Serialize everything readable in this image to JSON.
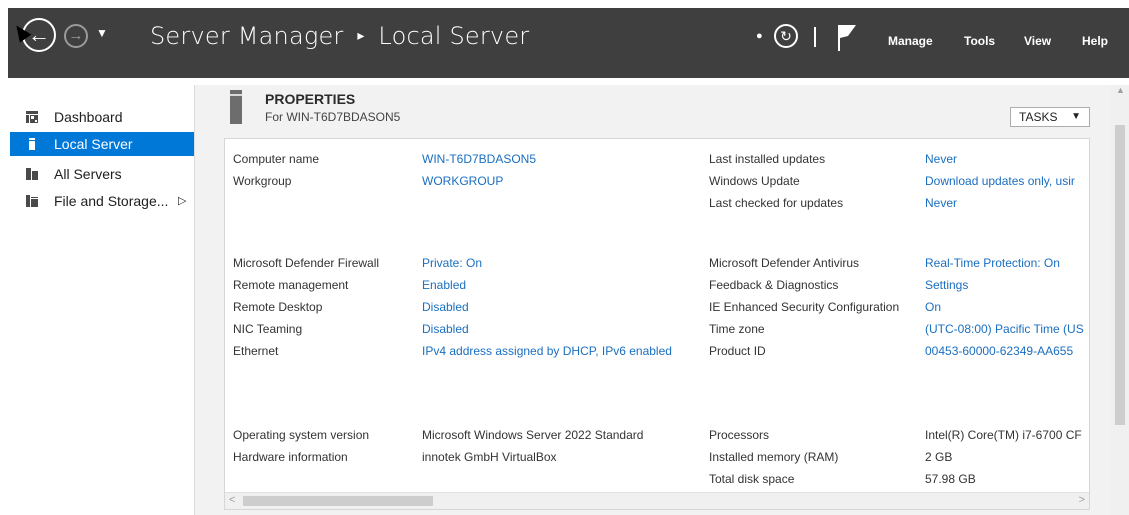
{
  "window": {
    "title": "Server Manager",
    "breadcrumb_sep": "▸",
    "section": "Local Server"
  },
  "header_menu": [
    "Manage",
    "Tools",
    "View",
    "Help"
  ],
  "sidebar": {
    "items": [
      {
        "label": "Dashboard",
        "active": false
      },
      {
        "label": "Local Server",
        "active": true
      },
      {
        "label": "All Servers",
        "active": false
      },
      {
        "label": "File and Storage...",
        "active": false
      }
    ],
    "expand_glyph": "▷"
  },
  "properties": {
    "title": "PROPERTIES",
    "subtitle": "For WIN-T6D7BDASON5",
    "tasks_label": "TASKS"
  },
  "left_props": [
    {
      "label": "Computer name",
      "value": "WIN-T6D7BDASON5",
      "link": true
    },
    {
      "label": "Workgroup",
      "value": "WORKGROUP",
      "link": true
    },
    {
      "label": "Microsoft Defender Firewall",
      "value": "Private: On",
      "link": true
    },
    {
      "label": "Remote management",
      "value": "Enabled",
      "link": true
    },
    {
      "label": "Remote Desktop",
      "value": "Disabled",
      "link": true
    },
    {
      "label": "NIC Teaming",
      "value": "Disabled",
      "link": true
    },
    {
      "label": "Ethernet",
      "value": "IPv4 address assigned by DHCP, IPv6 enabled",
      "link": true
    },
    {
      "label": "Operating system version",
      "value": "Microsoft Windows Server 2022 Standard",
      "link": false
    },
    {
      "label": "Hardware information",
      "value": "innotek GmbH VirtualBox",
      "link": false
    }
  ],
  "right_props": [
    {
      "label": "Last installed updates",
      "value": "Never",
      "link": true
    },
    {
      "label": "Windows Update",
      "value": "Download updates only, usir",
      "link": true
    },
    {
      "label": "Last checked for updates",
      "value": "Never",
      "link": true
    },
    {
      "label": "Microsoft Defender Antivirus",
      "value": "Real-Time Protection: On",
      "link": true
    },
    {
      "label": "Feedback & Diagnostics",
      "value": "Settings",
      "link": true
    },
    {
      "label": "IE Enhanced Security Configuration",
      "value": "On",
      "link": true
    },
    {
      "label": "Time zone",
      "value": "(UTC-08:00) Pacific Time (US",
      "link": true
    },
    {
      "label": "Product ID",
      "value": "00453-60000-62349-AA655",
      "link": true
    },
    {
      "label": "Processors",
      "value": "Intel(R) Core(TM) i7-6700 CF",
      "link": false
    },
    {
      "label": "Installed memory (RAM)",
      "value": "2 GB",
      "link": false
    },
    {
      "label": "Total disk space",
      "value": "57.98 GB",
      "link": false
    }
  ],
  "colors": {
    "titlebar": "#3f3f3f",
    "accent": "#0078d7",
    "link": "#1a6fc0"
  }
}
